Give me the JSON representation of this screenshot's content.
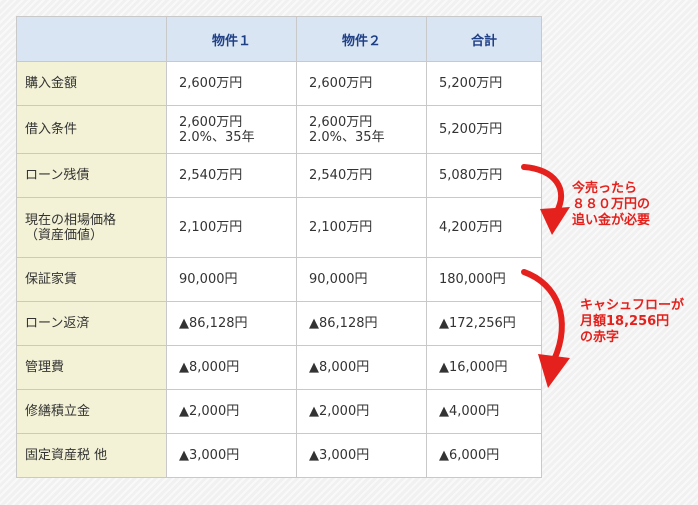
{
  "table": {
    "headers": [
      "",
      "物件１",
      "物件２",
      "合計"
    ],
    "rows": [
      {
        "label": [
          "購入金額"
        ],
        "cells": [
          [
            "2,600万円"
          ],
          [
            "2,600万円"
          ],
          [
            "5,200万円"
          ]
        ]
      },
      {
        "label": [
          "借入条件"
        ],
        "cells": [
          [
            "2,600万円",
            "2.0%、35年"
          ],
          [
            "2,600万円",
            "2.0%、35年"
          ],
          [
            "5,200万円"
          ]
        ]
      },
      {
        "label": [
          "ローン残債"
        ],
        "cells": [
          [
            "2,540万円"
          ],
          [
            "2,540万円"
          ],
          [
            "5,080万円"
          ]
        ]
      },
      {
        "label": [
          "現在の相場価格",
          "（資産価値）"
        ],
        "cells": [
          [
            "2,100万円"
          ],
          [
            "2,100万円"
          ],
          [
            "4,200万円"
          ]
        ]
      },
      {
        "label": [
          "保証家賃"
        ],
        "cells": [
          [
            "90,000円"
          ],
          [
            "90,000円"
          ],
          [
            "180,000円"
          ]
        ]
      },
      {
        "label": [
          "ローン返済"
        ],
        "cells": [
          [
            "▲86,128円"
          ],
          [
            "▲86,128円"
          ],
          [
            "▲172,256円"
          ]
        ]
      },
      {
        "label": [
          "管理費"
        ],
        "cells": [
          [
            "▲8,000円"
          ],
          [
            "▲8,000円"
          ],
          [
            "▲16,000円"
          ]
        ]
      },
      {
        "label": [
          "修繕積立金"
        ],
        "cells": [
          [
            "▲2,000円"
          ],
          [
            "▲2,000円"
          ],
          [
            "▲4,000円"
          ]
        ]
      },
      {
        "label": [
          "固定資産税 他"
        ],
        "cells": [
          [
            "▲3,000円"
          ],
          [
            "▲3,000円"
          ],
          [
            "▲6,000円"
          ]
        ]
      }
    ]
  },
  "annotations": {
    "sale_loss": [
      "今売ったら",
      "８８０万円の",
      "追い金が必要"
    ],
    "cashflow_loss": [
      "キャシュフローが",
      "月額18,256円",
      "の赤字"
    ]
  },
  "colors": {
    "header_bg": "#d9e5f3",
    "header_text": "#1f3f86",
    "label_bg": "#f3f2d6",
    "accent_red": "#e4211c"
  }
}
